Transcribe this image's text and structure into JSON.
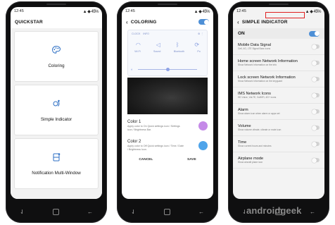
{
  "phone1": {
    "status": {
      "time": "12:45",
      "icons": "▲ ◆ 45%"
    },
    "title": "QUICKSTAR",
    "cards": [
      {
        "label": "Coloring",
        "icon": "palette-icon"
      },
      {
        "label": "Simple Indicator",
        "icon": "indicator-icon"
      },
      {
        "label": "Notification Multi-Window",
        "icon": "multi-window-icon"
      }
    ]
  },
  "phone2": {
    "status": {
      "time": "12:45",
      "icons": "▲ ◆ 45%"
    },
    "title": "COLORING",
    "preview": {
      "tab_left": "CLOCK",
      "tab_right": "INFO",
      "tiles": [
        "Wi-Fi",
        "Sound",
        "Bluetooth",
        "Po"
      ]
    },
    "colors": [
      {
        "title": "Color 1",
        "desc": "Apply color to On Quick settings icon / Settings icon / Brightness Bar.",
        "swatch": "#c58ae8"
      },
      {
        "title": "Color 2",
        "desc": "Apply color to Off Quick settings icon / Time / Date / Brightness Icon.",
        "swatch": "#4ea4ea"
      }
    ],
    "buttons": {
      "cancel": "CANCEL",
      "save": "SAVE"
    }
  },
  "phone3": {
    "status": {
      "time": "12:45",
      "icons": "▲ ◆ 45%"
    },
    "title": "SIMPLE INDICATOR",
    "on_label": "ON",
    "items": [
      {
        "title": "Mobile Data Signal",
        "desc": "Cell, 4G, LTE Signal Bars Icons"
      },
      {
        "title": "Home screen Network Information",
        "desc": "Show Network Information on the info"
      },
      {
        "title": "Lock screen Network Information",
        "desc": "Show Network Information on the keyguard"
      },
      {
        "title": "IMS Network Icons",
        "desc": "HD Voice, VoLTE, VoWiFi, 4G+ icons"
      },
      {
        "title": "Alarm",
        "desc": "Show alarm icon when alarm or apps set"
      },
      {
        "title": "Volume",
        "desc": "Show volume vibrate, vibrate or mute icon"
      },
      {
        "title": "Time",
        "desc": "Show current hours and minutes"
      },
      {
        "title": "Airplane mode",
        "desc": "Show aircraft plane icon"
      }
    ]
  },
  "watermark": "androidgeek",
  "accent": "#4d8fd6"
}
